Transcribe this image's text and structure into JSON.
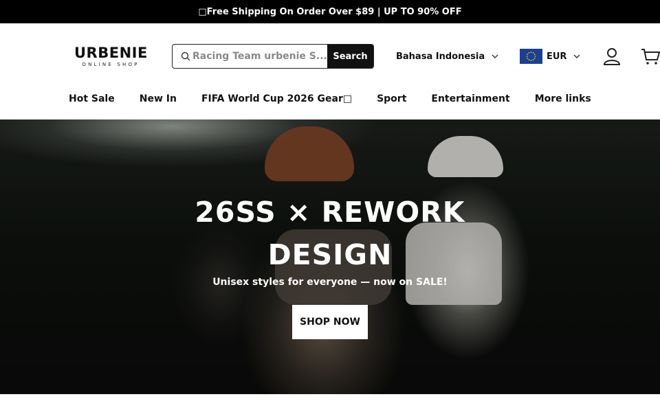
{
  "announcement": {
    "text": "□Free Shipping On Order Over $89 | UP TO 90% OFF"
  },
  "header": {
    "logo": {
      "main": "URBENIE",
      "sub": "ONLINE SHOP"
    },
    "search": {
      "placeholder": "Racing Team urbenie S...",
      "button_label": "Search",
      "icon": "search-icon"
    },
    "language": {
      "label": "Bahasa Indonesia",
      "icon": "chevron-down-icon"
    },
    "currency": {
      "label": "EUR",
      "flag": "eu-flag-icon",
      "icon": "chevron-down-icon"
    },
    "account_icon": "user-icon",
    "cart_icon": "cart-icon"
  },
  "nav": {
    "items": [
      {
        "label": "Hot Sale"
      },
      {
        "label": "New In"
      },
      {
        "label": "FIFA World Cup 2026 Gear□"
      },
      {
        "label": "Sport"
      },
      {
        "label": "Entertainment"
      },
      {
        "label": "More links"
      }
    ]
  },
  "hero": {
    "title_line1": "26SS × REWORK",
    "title_line2": "DESIGN",
    "subtitle": "Unisex styles for everyone — now on SALE!",
    "cta_label": "SHOP NOW"
  },
  "colors": {
    "announce_bg": "#000000",
    "accent": "#111111",
    "flag_blue": "#1b3f94"
  }
}
